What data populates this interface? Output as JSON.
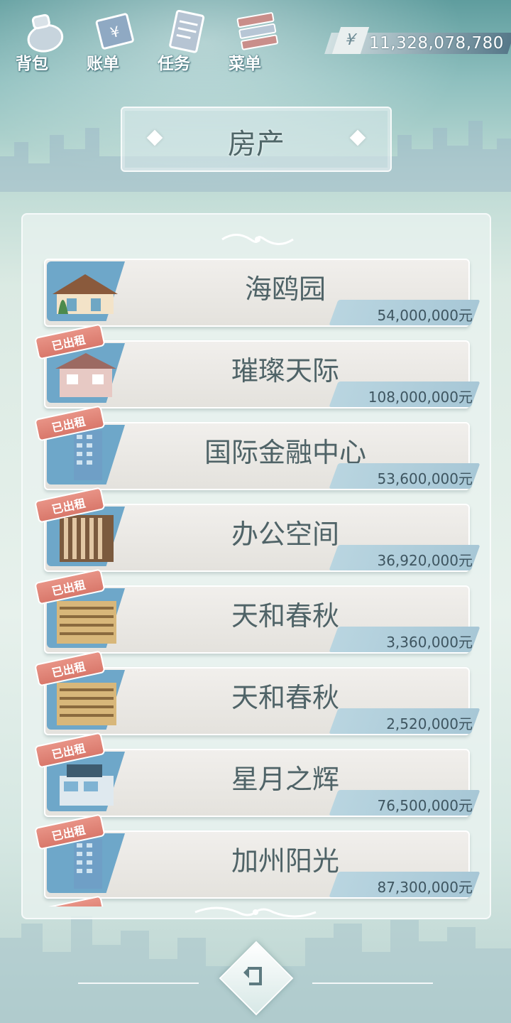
{
  "nav": {
    "items": [
      {
        "label": "背包",
        "icon": "bag-icon"
      },
      {
        "label": "账单",
        "icon": "bill-icon"
      },
      {
        "label": "任务",
        "icon": "task-icon"
      },
      {
        "label": "菜单",
        "icon": "menu-icon"
      }
    ]
  },
  "wallet": {
    "currency_symbol": "¥",
    "amount": "11,328,078,780"
  },
  "page": {
    "title": "房产"
  },
  "properties": [
    {
      "name": "海鸥园",
      "price": "54,000,000元",
      "badge": "",
      "image": "villa-icon"
    },
    {
      "name": "璀璨天际",
      "price": "108,000,000元",
      "badge": "已出租",
      "image": "house-icon"
    },
    {
      "name": "国际金融中心",
      "price": "53,600,000元",
      "badge": "已出租",
      "image": "tower-icon"
    },
    {
      "name": "办公空间",
      "price": "36,920,000元",
      "badge": "已出租",
      "image": "office-building-icon"
    },
    {
      "name": "天和春秋",
      "price": "3,360,000元",
      "badge": "已出租",
      "image": "apartment-icon"
    },
    {
      "name": "天和春秋",
      "price": "2,520,000元",
      "badge": "已出租",
      "image": "apartment-icon"
    },
    {
      "name": "星月之辉",
      "price": "76,500,000元",
      "badge": "已出租",
      "image": "modern-villa-icon"
    },
    {
      "name": "加州阳光",
      "price": "87,300,000元",
      "badge": "已出租",
      "image": "tower-icon"
    },
    {
      "name": "",
      "price": "",
      "badge": "已出租",
      "image": "apartment-icon"
    }
  ],
  "colors": {
    "badge": "#d9786b",
    "price_tag": "#a7c7d6",
    "thumb_frame": "#6ea7c9",
    "text": "#4f6367"
  }
}
